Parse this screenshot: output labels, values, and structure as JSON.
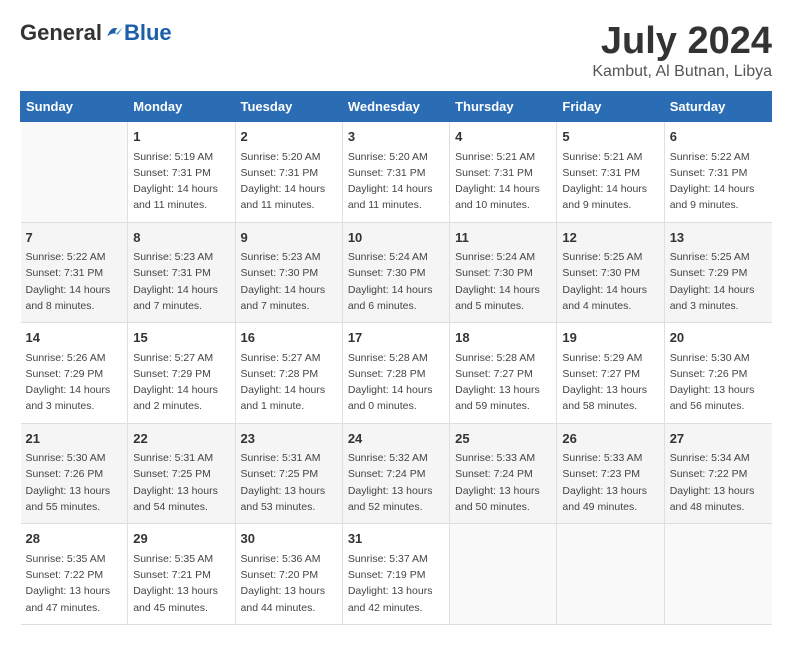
{
  "header": {
    "logo_general": "General",
    "logo_blue": "Blue",
    "main_title": "July 2024",
    "subtitle": "Kambut, Al Butnan, Libya"
  },
  "calendar": {
    "columns": [
      "Sunday",
      "Monday",
      "Tuesday",
      "Wednesday",
      "Thursday",
      "Friday",
      "Saturday"
    ],
    "rows": [
      [
        {
          "day": "",
          "sunrise": "",
          "sunset": "",
          "daylight": ""
        },
        {
          "day": "1",
          "sunrise": "Sunrise: 5:19 AM",
          "sunset": "Sunset: 7:31 PM",
          "daylight": "Daylight: 14 hours and 11 minutes."
        },
        {
          "day": "2",
          "sunrise": "Sunrise: 5:20 AM",
          "sunset": "Sunset: 7:31 PM",
          "daylight": "Daylight: 14 hours and 11 minutes."
        },
        {
          "day": "3",
          "sunrise": "Sunrise: 5:20 AM",
          "sunset": "Sunset: 7:31 PM",
          "daylight": "Daylight: 14 hours and 11 minutes."
        },
        {
          "day": "4",
          "sunrise": "Sunrise: 5:21 AM",
          "sunset": "Sunset: 7:31 PM",
          "daylight": "Daylight: 14 hours and 10 minutes."
        },
        {
          "day": "5",
          "sunrise": "Sunrise: 5:21 AM",
          "sunset": "Sunset: 7:31 PM",
          "daylight": "Daylight: 14 hours and 9 minutes."
        },
        {
          "day": "6",
          "sunrise": "Sunrise: 5:22 AM",
          "sunset": "Sunset: 7:31 PM",
          "daylight": "Daylight: 14 hours and 9 minutes."
        }
      ],
      [
        {
          "day": "7",
          "sunrise": "Sunrise: 5:22 AM",
          "sunset": "Sunset: 7:31 PM",
          "daylight": "Daylight: 14 hours and 8 minutes."
        },
        {
          "day": "8",
          "sunrise": "Sunrise: 5:23 AM",
          "sunset": "Sunset: 7:31 PM",
          "daylight": "Daylight: 14 hours and 7 minutes."
        },
        {
          "day": "9",
          "sunrise": "Sunrise: 5:23 AM",
          "sunset": "Sunset: 7:30 PM",
          "daylight": "Daylight: 14 hours and 7 minutes."
        },
        {
          "day": "10",
          "sunrise": "Sunrise: 5:24 AM",
          "sunset": "Sunset: 7:30 PM",
          "daylight": "Daylight: 14 hours and 6 minutes."
        },
        {
          "day": "11",
          "sunrise": "Sunrise: 5:24 AM",
          "sunset": "Sunset: 7:30 PM",
          "daylight": "Daylight: 14 hours and 5 minutes."
        },
        {
          "day": "12",
          "sunrise": "Sunrise: 5:25 AM",
          "sunset": "Sunset: 7:30 PM",
          "daylight": "Daylight: 14 hours and 4 minutes."
        },
        {
          "day": "13",
          "sunrise": "Sunrise: 5:25 AM",
          "sunset": "Sunset: 7:29 PM",
          "daylight": "Daylight: 14 hours and 3 minutes."
        }
      ],
      [
        {
          "day": "14",
          "sunrise": "Sunrise: 5:26 AM",
          "sunset": "Sunset: 7:29 PM",
          "daylight": "Daylight: 14 hours and 3 minutes."
        },
        {
          "day": "15",
          "sunrise": "Sunrise: 5:27 AM",
          "sunset": "Sunset: 7:29 PM",
          "daylight": "Daylight: 14 hours and 2 minutes."
        },
        {
          "day": "16",
          "sunrise": "Sunrise: 5:27 AM",
          "sunset": "Sunset: 7:28 PM",
          "daylight": "Daylight: 14 hours and 1 minute."
        },
        {
          "day": "17",
          "sunrise": "Sunrise: 5:28 AM",
          "sunset": "Sunset: 7:28 PM",
          "daylight": "Daylight: 14 hours and 0 minutes."
        },
        {
          "day": "18",
          "sunrise": "Sunrise: 5:28 AM",
          "sunset": "Sunset: 7:27 PM",
          "daylight": "Daylight: 13 hours and 59 minutes."
        },
        {
          "day": "19",
          "sunrise": "Sunrise: 5:29 AM",
          "sunset": "Sunset: 7:27 PM",
          "daylight": "Daylight: 13 hours and 58 minutes."
        },
        {
          "day": "20",
          "sunrise": "Sunrise: 5:30 AM",
          "sunset": "Sunset: 7:26 PM",
          "daylight": "Daylight: 13 hours and 56 minutes."
        }
      ],
      [
        {
          "day": "21",
          "sunrise": "Sunrise: 5:30 AM",
          "sunset": "Sunset: 7:26 PM",
          "daylight": "Daylight: 13 hours and 55 minutes."
        },
        {
          "day": "22",
          "sunrise": "Sunrise: 5:31 AM",
          "sunset": "Sunset: 7:25 PM",
          "daylight": "Daylight: 13 hours and 54 minutes."
        },
        {
          "day": "23",
          "sunrise": "Sunrise: 5:31 AM",
          "sunset": "Sunset: 7:25 PM",
          "daylight": "Daylight: 13 hours and 53 minutes."
        },
        {
          "day": "24",
          "sunrise": "Sunrise: 5:32 AM",
          "sunset": "Sunset: 7:24 PM",
          "daylight": "Daylight: 13 hours and 52 minutes."
        },
        {
          "day": "25",
          "sunrise": "Sunrise: 5:33 AM",
          "sunset": "Sunset: 7:24 PM",
          "daylight": "Daylight: 13 hours and 50 minutes."
        },
        {
          "day": "26",
          "sunrise": "Sunrise: 5:33 AM",
          "sunset": "Sunset: 7:23 PM",
          "daylight": "Daylight: 13 hours and 49 minutes."
        },
        {
          "day": "27",
          "sunrise": "Sunrise: 5:34 AM",
          "sunset": "Sunset: 7:22 PM",
          "daylight": "Daylight: 13 hours and 48 minutes."
        }
      ],
      [
        {
          "day": "28",
          "sunrise": "Sunrise: 5:35 AM",
          "sunset": "Sunset: 7:22 PM",
          "daylight": "Daylight: 13 hours and 47 minutes."
        },
        {
          "day": "29",
          "sunrise": "Sunrise: 5:35 AM",
          "sunset": "Sunset: 7:21 PM",
          "daylight": "Daylight: 13 hours and 45 minutes."
        },
        {
          "day": "30",
          "sunrise": "Sunrise: 5:36 AM",
          "sunset": "Sunset: 7:20 PM",
          "daylight": "Daylight: 13 hours and 44 minutes."
        },
        {
          "day": "31",
          "sunrise": "Sunrise: 5:37 AM",
          "sunset": "Sunset: 7:19 PM",
          "daylight": "Daylight: 13 hours and 42 minutes."
        },
        {
          "day": "",
          "sunrise": "",
          "sunset": "",
          "daylight": ""
        },
        {
          "day": "",
          "sunrise": "",
          "sunset": "",
          "daylight": ""
        },
        {
          "day": "",
          "sunrise": "",
          "sunset": "",
          "daylight": ""
        }
      ]
    ]
  }
}
